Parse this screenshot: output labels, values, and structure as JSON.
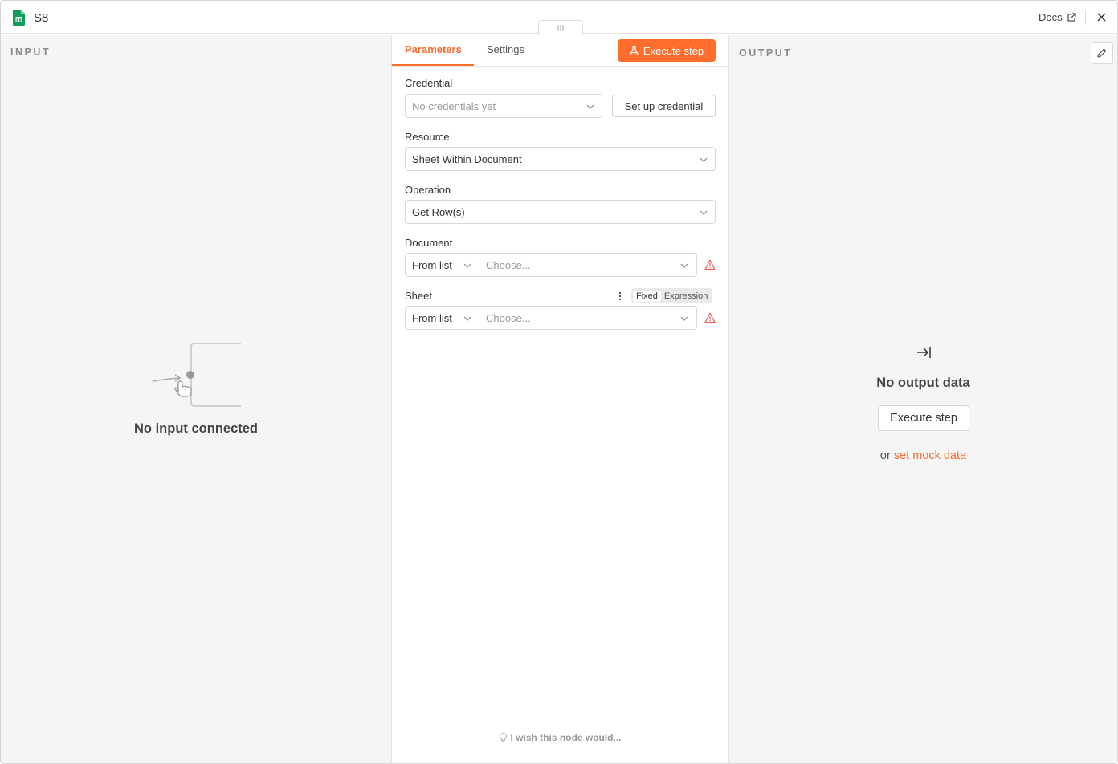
{
  "header": {
    "node_title": "S8",
    "docs_label": "Docs"
  },
  "input_panel": {
    "label": "INPUT",
    "empty_message": "No input connected"
  },
  "params_panel": {
    "tabs": [
      {
        "label": "Parameters",
        "active": true
      },
      {
        "label": "Settings",
        "active": false
      }
    ],
    "execute_label": "Execute step",
    "credential": {
      "label": "Credential",
      "placeholder": "No credentials yet",
      "setup_label": "Set up credential"
    },
    "resource": {
      "label": "Resource",
      "value": "Sheet Within Document"
    },
    "operation": {
      "label": "Operation",
      "value": "Get Row(s)"
    },
    "document": {
      "label": "Document",
      "mode": "From list",
      "placeholder": "Choose..."
    },
    "sheet": {
      "label": "Sheet",
      "mode": "From list",
      "placeholder": "Choose...",
      "toggle_fixed": "Fixed",
      "toggle_expression": "Expression"
    },
    "wish_label": "I wish this node would..."
  },
  "output_panel": {
    "label": "OUTPUT",
    "empty_message": "No output data",
    "execute_label": "Execute step",
    "or_text": "or",
    "mock_link": "set mock data"
  },
  "colors": {
    "accent": "#ff6d2c",
    "panel_bg": "#f5f5f5",
    "warning": "#f45959",
    "sheets_green": "#0f9d58"
  }
}
